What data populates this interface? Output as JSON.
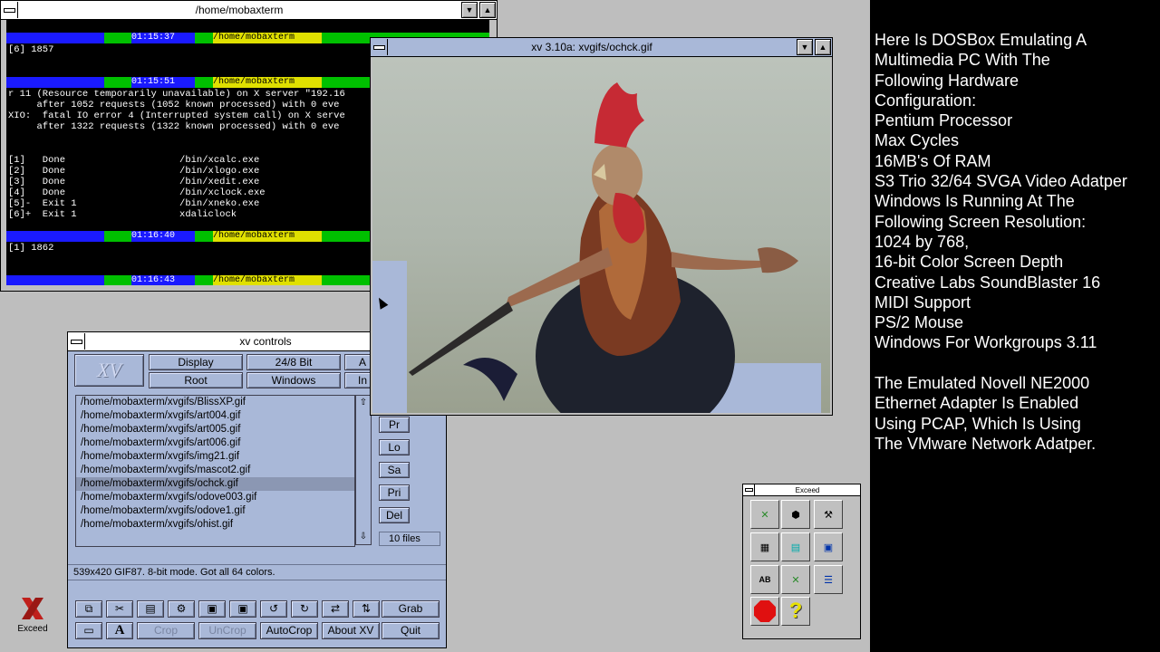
{
  "terminal": {
    "title": "/home/mobaxterm",
    "prompts": [
      {
        "time": "01:15:37",
        "path": "/home/mobaxterm"
      },
      {
        "time": "01:15:51",
        "path": "/home/mobaxterm"
      },
      {
        "time": "01:16:40",
        "path": "/home/mobaxterm"
      },
      {
        "time": "01:16:43",
        "path": "/home/mobaxterm"
      }
    ],
    "lines": {
      "l_after_p1": "[6] 1857",
      "e1": "r 11 (Resource temporarily unavailable) on X server \"192.16",
      "e2": "     after 1052 requests (1052 known processed) with 0 eve",
      "e3": "XIO:  fatal IO error 4 (Interrupted system call) on X serve",
      "e4": "     after 1322 requests (1322 known processed) with 0 eve",
      "j1": "[1]   Done                    /bin/xcalc.exe",
      "j2": "[2]   Done                    /bin/xlogo.exe",
      "j3": "[3]   Done                    /bin/xedit.exe",
      "j4": "[4]   Done                    /bin/xclock.exe",
      "j5": "[5]-  Exit 1                  /bin/xneko.exe",
      "j6": "[6]+  Exit 1                  xdaliclock",
      "l_after_p3": "[1] 1862"
    }
  },
  "xv_image": {
    "title": "xv 3.10a: xvgifs/ochck.gif"
  },
  "xv_controls": {
    "title": "xv controls",
    "logo": "XV",
    "buttons": {
      "display": "Display",
      "bit": "24/8 Bit",
      "algs": "A",
      "root": "Root",
      "windows": "Windows",
      "info": "In",
      "prev": "Pr",
      "load": "Lo",
      "save": "Sa",
      "print": "Pri",
      "delete": "Del"
    },
    "files": [
      "/home/mobaxterm/xvgifs/BlissXP.gif",
      "/home/mobaxterm/xvgifs/art004.gif",
      "/home/mobaxterm/xvgifs/art005.gif",
      "/home/mobaxterm/xvgifs/art006.gif",
      "/home/mobaxterm/xvgifs/img21.gif",
      "/home/mobaxterm/xvgifs/mascot2.gif",
      "/home/mobaxterm/xvgifs/ochck.gif",
      "/home/mobaxterm/xvgifs/odove003.gif",
      "/home/mobaxterm/xvgifs/odove1.gif",
      "/home/mobaxterm/xvgifs/ohist.gif"
    ],
    "selected_index": 6,
    "file_count": "10 files",
    "status": "539x420 GIF87.  8-bit mode.  Got all 64 colors.",
    "bottom": {
      "grab": "Grab",
      "crop": "Crop",
      "uncrop": "UnCrop",
      "autocrop": "AutoCrop",
      "about": "About XV",
      "quit": "Quit"
    }
  },
  "exceed_toolbox": {
    "title": "Exceed"
  },
  "desktop_icon": {
    "label": "Exceed"
  },
  "info_panel": {
    "lines": [
      "Here Is DOSBox Emulating A",
      "Multimedia PC With The",
      "Following Hardware",
      "Configuration:",
      "Pentium Processor",
      "Max Cycles",
      "16MB's Of RAM",
      "S3 Trio 32/64 SVGA Video Adatper",
      "Windows Is Running At The",
      "Following Screen Resolution:",
      "1024 by 768,",
      "16-bit  Color Screen Depth",
      "Creative Labs SoundBlaster 16",
      "MIDI Support",
      "PS/2 Mouse",
      "Windows For Workgroups 3.11",
      "",
      "The Emulated Novell NE2000",
      "Ethernet Adapter Is Enabled",
      "Using PCAP, Which Is Using",
      "The VMware Network Adatper."
    ]
  },
  "colors": {
    "desktop": "#bebebe",
    "xv_panel": "#a9b8d8",
    "prompt_blue": "#1a1aff",
    "prompt_green": "#00c000",
    "prompt_yellow": "#e0e000"
  }
}
